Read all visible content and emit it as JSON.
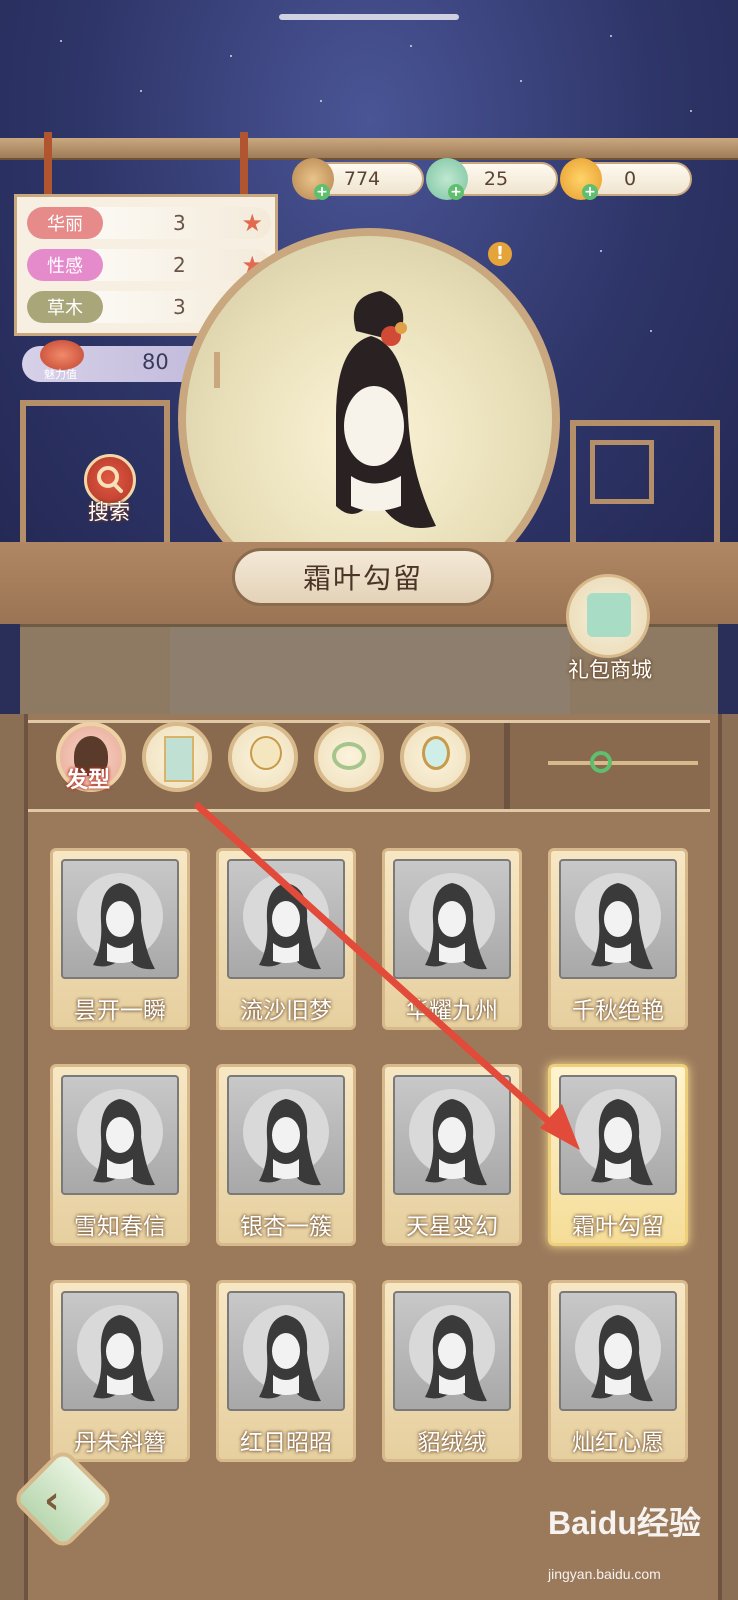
{
  "currency": {
    "coins": "774",
    "jade": "25",
    "gold": "0"
  },
  "stats": [
    {
      "label": "华丽",
      "value": "3",
      "color": "#e68a8a"
    },
    {
      "label": "性感",
      "value": "2",
      "color": "#e58acb"
    },
    {
      "label": "草木",
      "value": "3",
      "color": "#a9a77a"
    }
  ],
  "charm": {
    "label": "魅力值",
    "value": "80"
  },
  "search_label": "搜索",
  "selected_item_name": "霜叶勾留",
  "gift_label": "礼包商城",
  "tabs": [
    {
      "label": "发型",
      "icon": "hairstyle-icon",
      "active": true
    },
    {
      "label": "",
      "icon": "dress-icon",
      "active": false
    },
    {
      "label": "",
      "icon": "fan-icon",
      "active": false
    },
    {
      "label": "",
      "icon": "bracelet-icon",
      "active": false
    },
    {
      "label": "",
      "icon": "mirror-icon",
      "active": false
    }
  ],
  "items": [
    {
      "name": "昙开一瞬"
    },
    {
      "name": "流沙旧梦"
    },
    {
      "name": "华耀九州"
    },
    {
      "name": "千秋绝艳"
    },
    {
      "name": "雪知春信"
    },
    {
      "name": "银杏一簇"
    },
    {
      "name": "天星变幻"
    },
    {
      "name": "霜叶勾留",
      "selected": true
    },
    {
      "name": "丹朱斜簪"
    },
    {
      "name": "红日昭昭"
    },
    {
      "name": "貂绒绒"
    },
    {
      "name": "灿红心愿"
    }
  ],
  "watermark": {
    "brand": "Baidu经验",
    "url": "jingyan.baidu.com"
  },
  "colors": {
    "accent": "#e26a4f",
    "wood": "#9b7a5c",
    "selected_glow": "#f7e18e",
    "annotation_arrow": "#e24a3a"
  }
}
